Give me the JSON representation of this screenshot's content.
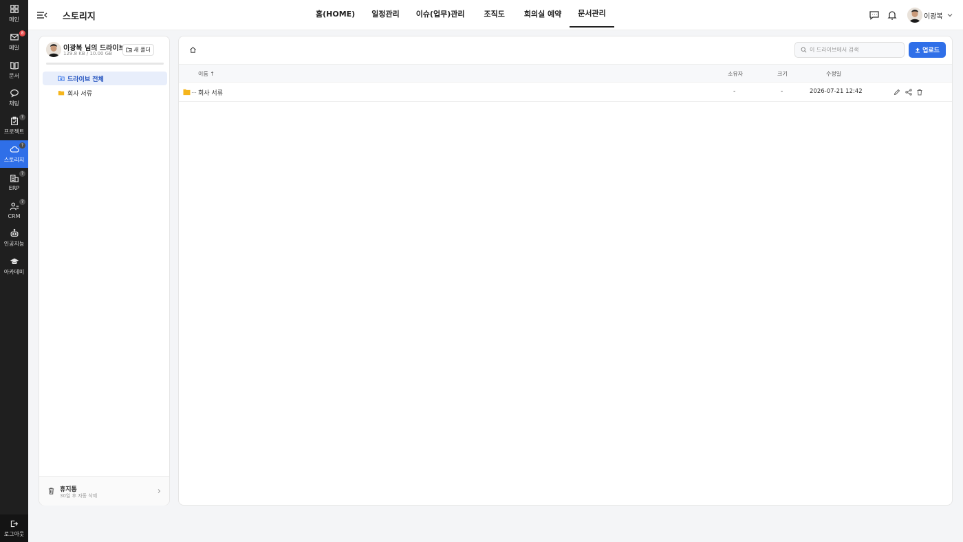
{
  "rail": {
    "items": [
      {
        "label": "메인",
        "badge": ""
      },
      {
        "label": "메일",
        "badge": "8"
      },
      {
        "label": "문서",
        "badge": ""
      },
      {
        "label": "채팅",
        "badge": ""
      },
      {
        "label": "프로젝트",
        "badge": "?"
      },
      {
        "label": "스토리지",
        "badge": "?"
      },
      {
        "label": "ERP",
        "badge": "?"
      },
      {
        "label": "CRM",
        "badge": "?"
      },
      {
        "label": "인공지능",
        "badge": ""
      },
      {
        "label": "아카데미",
        "badge": ""
      }
    ],
    "active_index": 5,
    "logout_label": "로그아웃"
  },
  "header": {
    "title": "스토리지",
    "nav": [
      "홈(HOME)",
      "일정관리",
      "이슈(업무)관리",
      "조직도",
      "회의실 예약",
      "문서관리"
    ],
    "active_nav": "문서관리",
    "user_name": "이광복"
  },
  "sidebar": {
    "drive_title": "이광복 님의 드라이브",
    "usage_text": "129.8 KB / 10.00 GB",
    "usage_fraction": 1.27e-05,
    "new_folder_label": "새 폴더",
    "tree": [
      {
        "label": "드라이브 전체",
        "active": true
      },
      {
        "label": "회사 서류",
        "active": false
      }
    ],
    "trash": {
      "title": "휴지통",
      "subtitle": "30일 후 자동 삭제"
    }
  },
  "main": {
    "search_placeholder": "이 드라이브에서 검색",
    "upload_label": "업로드",
    "columns": {
      "name": "이름 ↑",
      "owner": "소유자",
      "size": "크기",
      "modified": "수정일"
    },
    "rows": [
      {
        "name": "회사 서류",
        "owner": "-",
        "size": "-",
        "modified": "2026-07-21 12:42"
      }
    ]
  },
  "colors": {
    "accent": "#2f6fe8",
    "rail_bg": "#1f1f1f",
    "folder": "#f5b51c",
    "badge_red": "#e54848"
  }
}
